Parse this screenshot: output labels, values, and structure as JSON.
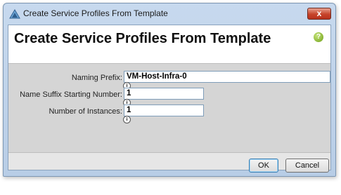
{
  "window": {
    "title": "Create Service Profiles From Template",
    "close_label": "x"
  },
  "header": {
    "heading": "Create Service Profiles From Template",
    "help_label": "?"
  },
  "form": {
    "naming_prefix": {
      "label": "Naming Prefix:",
      "value": "VM-Host-Infra-0"
    },
    "suffix_start": {
      "label": "Name Suffix Starting Number:",
      "value": "1"
    },
    "instances": {
      "label": "Number of Instances:",
      "value": "1"
    },
    "info_glyph": "i"
  },
  "footer": {
    "ok_label": "OK",
    "cancel_label": "Cancel"
  }
}
